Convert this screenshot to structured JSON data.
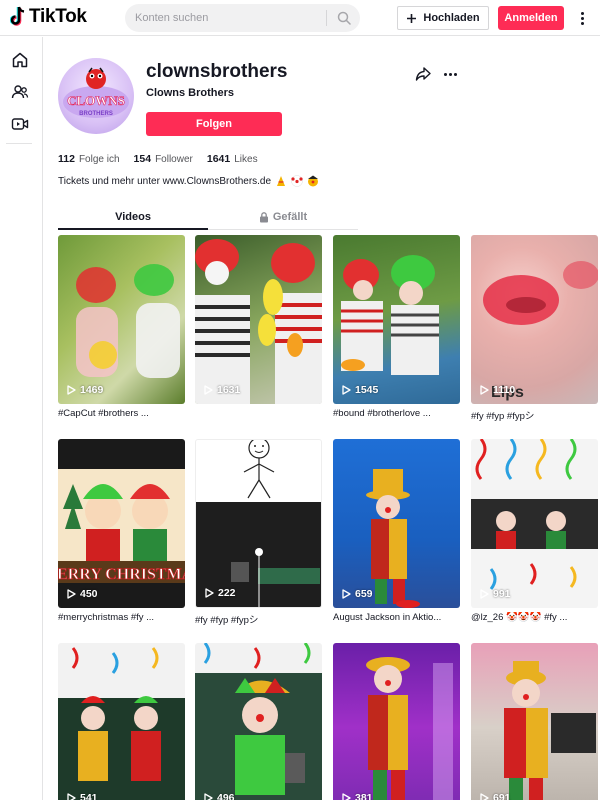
{
  "header": {
    "logo_text": "TikTok",
    "search_placeholder": "Konten suchen",
    "upload_label": "Hochladen",
    "login_label": "Anmelden"
  },
  "profile": {
    "username": "clownsbrothers",
    "nickname": "Clowns Brothers",
    "follow_label": "Folgen",
    "avatar_text": "CLOWNS BROTHERS",
    "stats": [
      {
        "value": "112",
        "label": "Folge ich"
      },
      {
        "value": "154",
        "label": "Follower"
      },
      {
        "value": "1641",
        "label": "Likes"
      }
    ],
    "bio": "Tickets und mehr unter www.ClownsBrothers.de"
  },
  "tabs": {
    "videos": "Videos",
    "liked": "Gefällt"
  },
  "videos": [
    {
      "views": "1469",
      "caption": "#CapCut #brothers ..."
    },
    {
      "views": "1631",
      "caption": ""
    },
    {
      "views": "1545",
      "caption": "#bound #brotherlove ..."
    },
    {
      "views": "1110",
      "caption": "#fy #fyp #fypシ",
      "overlay": "Lips"
    },
    {
      "views": "450",
      "caption": "#merrychristmas #fy ...",
      "overlay": "MERRY CHRISTMAS"
    },
    {
      "views": "222",
      "caption": "#fy #fyp #fypシ"
    },
    {
      "views": "659",
      "caption": "August Jackson in Aktio..."
    },
    {
      "views": "991",
      "caption": "@lz_26 🤡🤡🤡 #fy ..."
    },
    {
      "views": "541",
      "caption": ""
    },
    {
      "views": "496",
      "caption": ""
    },
    {
      "views": "381",
      "caption": ""
    },
    {
      "views": "691",
      "caption": ""
    }
  ],
  "colors": {
    "accent": "#fe2c55",
    "text": "#161823",
    "muted": "#8a8b91"
  }
}
